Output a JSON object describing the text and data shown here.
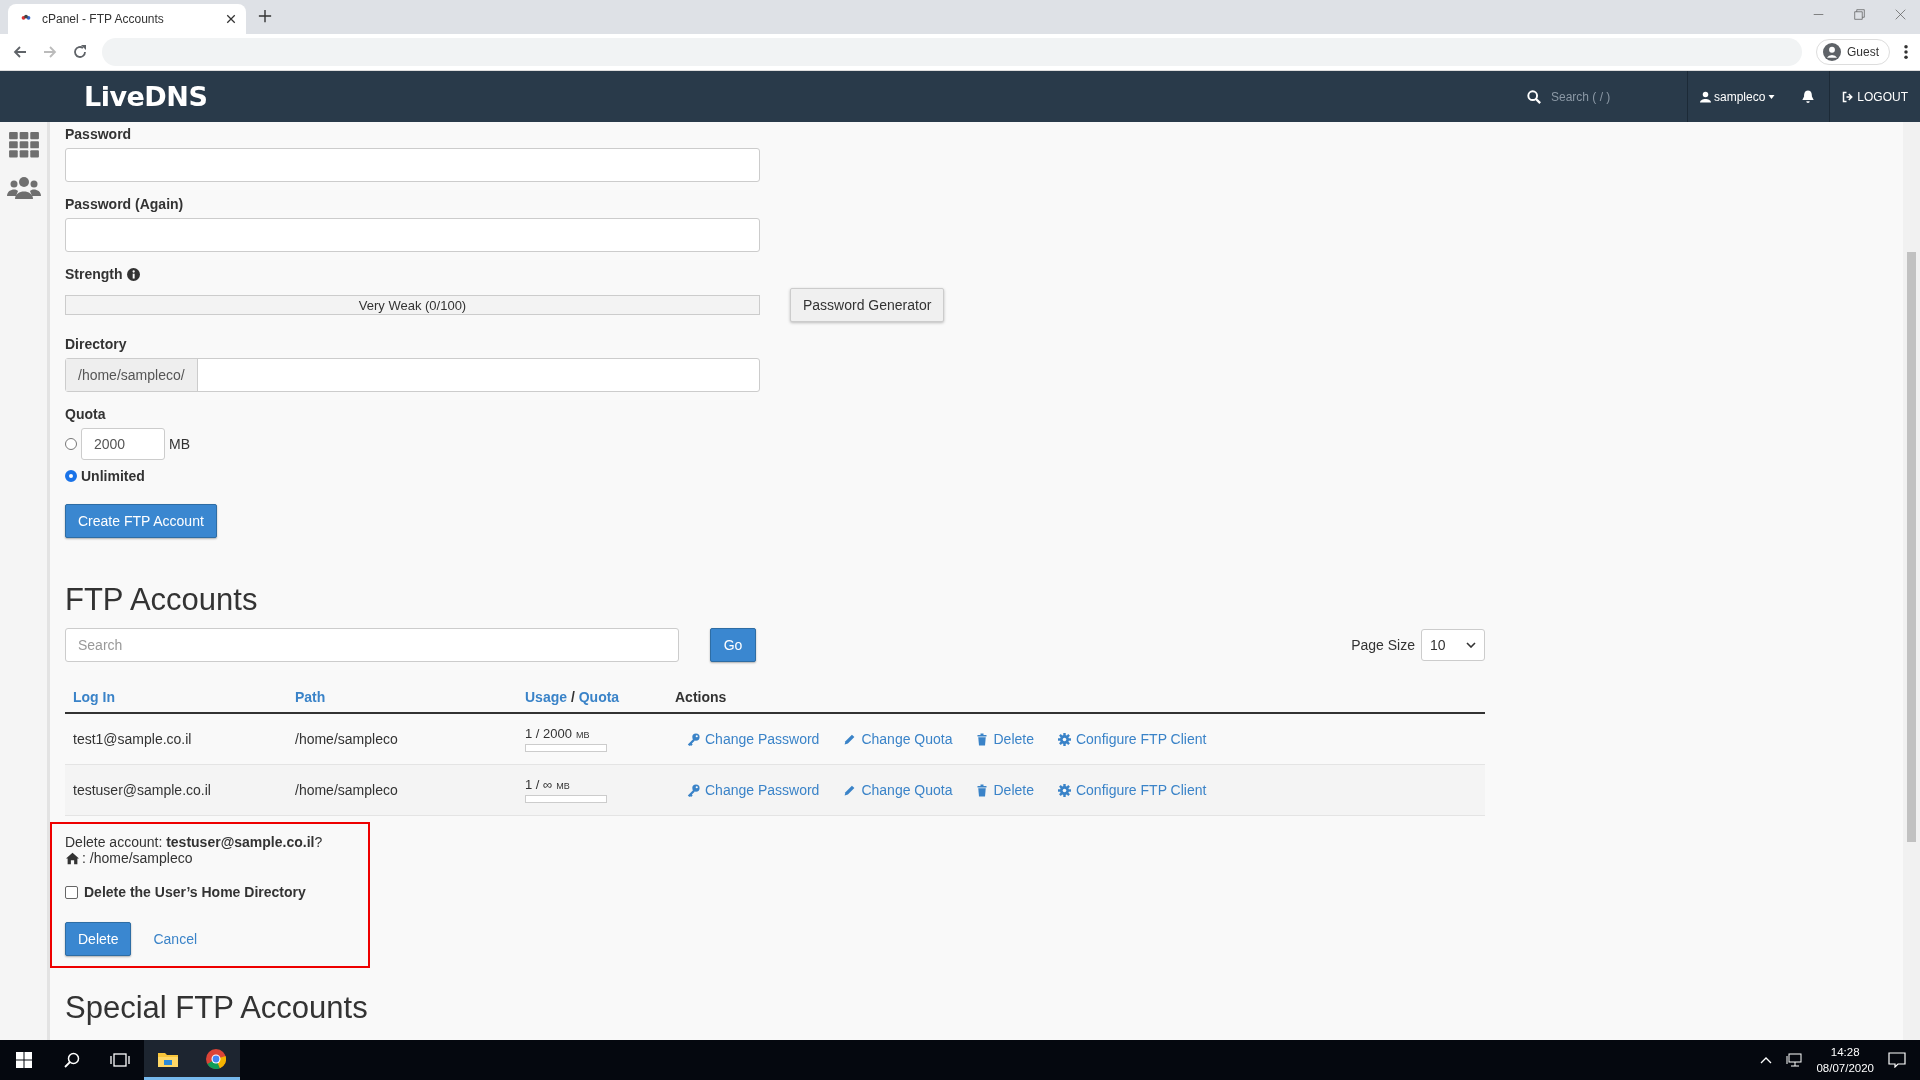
{
  "browser": {
    "tab_title": "cPanel - FTP Accounts",
    "profile": "Guest"
  },
  "header": {
    "logo": "LiveDNS",
    "search_placeholder": "Search ( / )",
    "user": "sampleco",
    "logout": "LOGOUT"
  },
  "form": {
    "password_label": "Password",
    "password_again_label": "Password (Again)",
    "strength_label": "Strength",
    "strength_text": "Very Weak (0/100)",
    "strength": {
      "level": 0
    },
    "generator_button": "Password Generator",
    "directory_label": "Directory",
    "directory_prefix": "/home/sampleco/",
    "quota_label": "Quota",
    "quota_options": [
      {
        "kind": "limited",
        "value": "2000",
        "unit": "MB",
        "selected": false
      },
      {
        "kind": "unlimited",
        "label": "Unlimited",
        "selected": true
      }
    ],
    "create_button": "Create FTP Account"
  },
  "accounts": {
    "heading": "FTP Accounts",
    "search_placeholder": "Search",
    "go_button": "Go",
    "page_size_label": "Page Size",
    "page_size": "10",
    "columns": [
      {
        "kind": "link",
        "label": "Log In"
      },
      {
        "kind": "link",
        "label": "Path"
      },
      {
        "kind": "usage",
        "label": "Usage",
        "separator": "/",
        "label_2": "Quota"
      },
      {
        "kind": "plain",
        "label": "Actions"
      }
    ],
    "rows": [
      {
        "login": "test1@sample.co.il",
        "path": "/home/sampleco",
        "usage": "1 / 2000",
        "unit": "MB",
        "level": 0,
        "actions": [
          {
            "kind": "key",
            "label": "Change Password"
          },
          {
            "kind": "pencil",
            "label": "Change Quota"
          },
          {
            "kind": "trash",
            "label": "Delete"
          },
          {
            "kind": "gear",
            "label": "Configure FTP Client"
          }
        ]
      },
      {
        "login": "testuser@sample.co.il",
        "path": "/home/sampleco",
        "usage": "1 / ∞",
        "unit": "MB",
        "level": 0,
        "actions": [
          {
            "kind": "key",
            "label": "Change Password"
          },
          {
            "kind": "pencil",
            "label": "Change Quota"
          },
          {
            "kind": "trash",
            "label": "Delete"
          },
          {
            "kind": "gear",
            "label": "Configure FTP Client"
          }
        ]
      }
    ]
  },
  "delete_confirm": {
    "prompt": "Delete account: **testuser@sample.co.il**?",
    "home_path": ": /home/sampleco",
    "checkbox_label": "Delete the User’s Home Directory",
    "checked": false,
    "delete_button": "Delete",
    "cancel_link": "Cancel"
  },
  "next_heading": "Special FTP Accounts",
  "taskbar": {
    "time": "14:28",
    "date": "08/07/2020"
  }
}
